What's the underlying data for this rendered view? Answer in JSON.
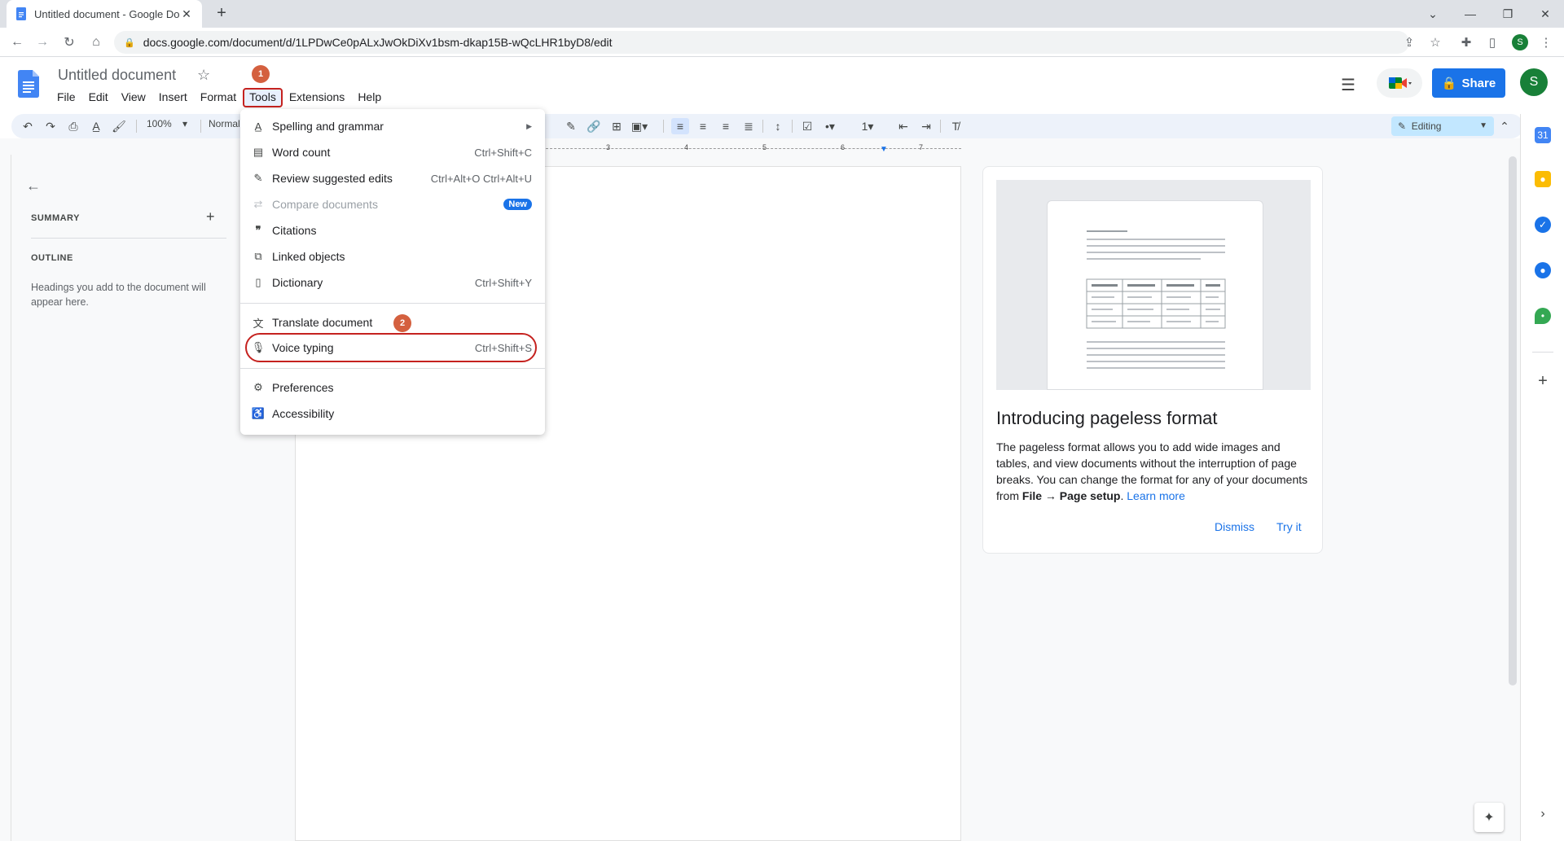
{
  "browser": {
    "tab_title": "Untitled document - Google Doc",
    "url": "docs.google.com/document/d/1LPDwCe0pALxJwOkDiXv1bsm-dkap15B-wQcLHR1byD8/edit",
    "profile_initial": "S"
  },
  "docs": {
    "title": "Untitled document",
    "menu": [
      "File",
      "Edit",
      "View",
      "Insert",
      "Format",
      "Tools",
      "Extensions",
      "Help"
    ],
    "share_label": "Share",
    "avatar_initial": "S",
    "zoom": "100%",
    "style": "Normal",
    "mode": "Editing"
  },
  "badges": {
    "step1": "1",
    "step2": "2"
  },
  "ruler": [
    "3",
    "4",
    "5",
    "6",
    "7"
  ],
  "outline": {
    "summary": "SUMMARY",
    "outline": "OUTLINE",
    "hint": "Headings you add to the document will appear here."
  },
  "tools_menu": {
    "items": [
      {
        "label": "Spelling and grammar",
        "shortcut": "",
        "icon": "spellcheck-icon"
      },
      {
        "label": "Word count",
        "shortcut": "Ctrl+Shift+C",
        "icon": "word-count-icon"
      },
      {
        "label": "Review suggested edits",
        "shortcut": "Ctrl+Alt+O Ctrl+Alt+U",
        "icon": "review-icon"
      },
      {
        "label": "Compare documents",
        "shortcut": "",
        "icon": "compare-icon",
        "badge": "New"
      },
      {
        "label": "Citations",
        "shortcut": "",
        "icon": "quote-icon"
      },
      {
        "label": "Linked objects",
        "shortcut": "",
        "icon": "link-objects-icon"
      },
      {
        "label": "Dictionary",
        "shortcut": "Ctrl+Shift+Y",
        "icon": "dictionary-icon"
      },
      {
        "label": "Translate document",
        "shortcut": "",
        "icon": "translate-icon"
      },
      {
        "label": "Voice typing",
        "shortcut": "Ctrl+Shift+S",
        "icon": "mic-icon"
      },
      {
        "label": "Preferences",
        "shortcut": "",
        "icon": "preferences-icon"
      },
      {
        "label": "Accessibility",
        "shortcut": "",
        "icon": "accessibility-icon"
      }
    ]
  },
  "card": {
    "title": "Introducing pageless format",
    "text_1": "The pageless format allows you to add wide images and tables, and view documents without the interruption of page breaks. You can change the format for any of your documents from ",
    "text_bold": "File → Page setup",
    "text_2": ". ",
    "link": "Learn more",
    "dismiss": "Dismiss",
    "try_it": "Try it"
  },
  "colors": {
    "accent": "#1a73e8",
    "highlight": "#c5221f",
    "badge": "#d4603f"
  }
}
